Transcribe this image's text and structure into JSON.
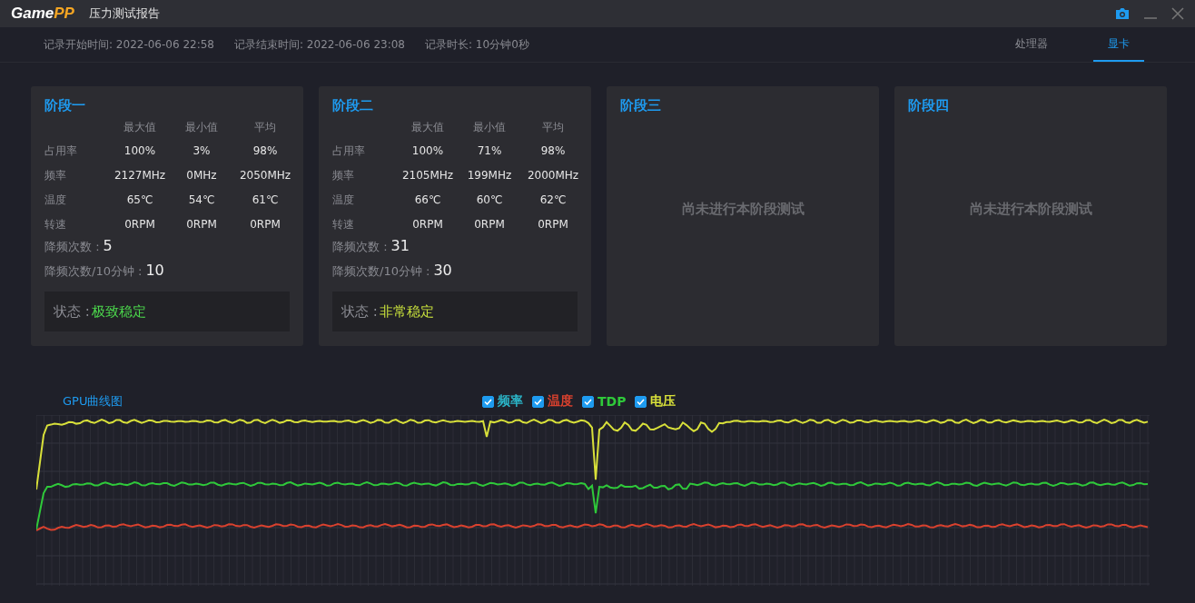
{
  "window": {
    "logo_left": "Game",
    "logo_right": "PP",
    "title": "压力测试报告"
  },
  "info": [
    {
      "text": "记录开始时间: 2022-06-06 22:58"
    },
    {
      "text": "记录结束时间: 2022-06-06 23:08"
    },
    {
      "text": "记录时长: 10分钟0秒"
    }
  ],
  "tabs": [
    {
      "label": "处理器",
      "selected": false
    },
    {
      "label": "显卡",
      "selected": true
    }
  ],
  "stages": [
    {
      "title": "阶段一",
      "kind": "done",
      "columns": [
        "最大值",
        "最小值",
        "平均"
      ],
      "rows": [
        {
          "label": "占用率",
          "values": [
            "100%",
            "3%",
            "98%"
          ]
        },
        {
          "label": "频率",
          "values": [
            "2127MHz",
            "0MHz",
            "2050MHz"
          ]
        },
        {
          "label": "温度",
          "values": [
            "65℃",
            "54℃",
            "61℃"
          ]
        },
        {
          "label": "转速",
          "values": [
            "0RPM",
            "0RPM",
            "0RPM"
          ]
        }
      ],
      "throttle_label": "降频次数 :",
      "throttle": "5",
      "throttle_rate_label": "降频次数/10分钟 :",
      "throttle_rate": "10",
      "status_label": "状态 :",
      "status": "极致稳定",
      "color": "#4cd94c"
    },
    {
      "title": "阶段二",
      "kind": "done",
      "columns": [
        "最大值",
        "最小值",
        "平均"
      ],
      "rows": [
        {
          "label": "占用率",
          "values": [
            "100%",
            "71%",
            "98%"
          ]
        },
        {
          "label": "频率",
          "values": [
            "2105MHz",
            "199MHz",
            "2000MHz"
          ]
        },
        {
          "label": "温度",
          "values": [
            "66℃",
            "60℃",
            "62℃"
          ]
        },
        {
          "label": "转速",
          "values": [
            "0RPM",
            "0RPM",
            "0RPM"
          ]
        }
      ],
      "throttle_label": "降频次数 :",
      "throttle": "31",
      "throttle_rate_label": "降频次数/10分钟 :",
      "throttle_rate": "30",
      "status_label": "状态 :",
      "status": "非常稳定",
      "color": "#c8e03c"
    },
    {
      "title": "阶段三",
      "kind": "empty",
      "message": "尚未进行本阶段测试"
    },
    {
      "title": "阶段四",
      "kind": "empty",
      "message": "尚未进行本阶段测试"
    }
  ],
  "chart": {
    "title": "GPU曲线图",
    "legend": [
      {
        "label": "频率",
        "checked": true,
        "color": "#2bb5c8"
      },
      {
        "label": "温度",
        "checked": true,
        "color": "#d9412e"
      },
      {
        "label": "TDP",
        "checked": true,
        "color": "#2fc93a"
      },
      {
        "label": "电压",
        "checked": true,
        "color": "#d8e03a"
      }
    ]
  }
}
